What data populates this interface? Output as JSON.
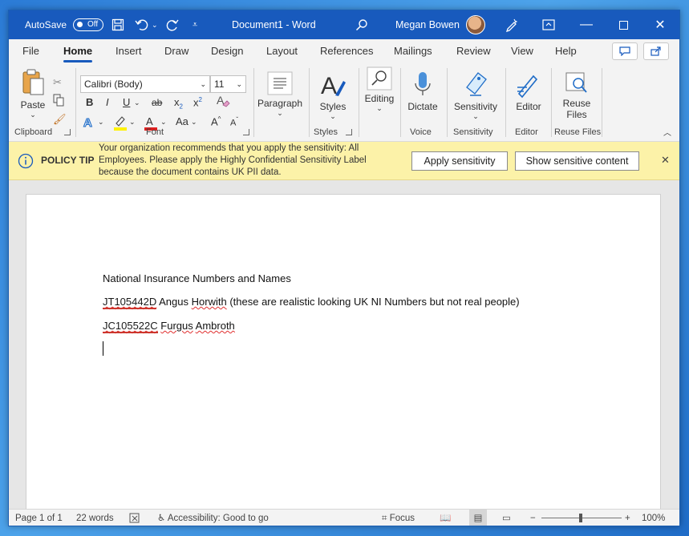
{
  "titlebar": {
    "autosave_label": "AutoSave",
    "autosave_state": "Off",
    "document_title": "Document1 - Word",
    "user_name": "Megan Bowen",
    "icons": [
      "save-icon",
      "undo-icon",
      "redo-icon",
      "customize-icon",
      "search-icon",
      "diamond-pen-icon",
      "ribbon-display-icon",
      "minimize-icon",
      "maximize-icon",
      "close-icon"
    ]
  },
  "tabs": [
    "File",
    "Home",
    "Insert",
    "Draw",
    "Design",
    "Layout",
    "References",
    "Mailings",
    "Review",
    "View",
    "Help"
  ],
  "active_tab": "Home",
  "ribbon": {
    "clipboard": {
      "paste_label": "Paste",
      "group_label": "Clipboard"
    },
    "font": {
      "font_name": "Calibri (Body)",
      "font_size": "11",
      "group_label": "Font",
      "bold": "B",
      "italic": "I",
      "underline": "U",
      "strikethrough": "ab",
      "subscript": "x",
      "sub_mark": "2",
      "superscript": "x",
      "sup_mark": "2",
      "case": "Aa",
      "grow": "A",
      "shrink": "A",
      "font_color_accent": "#e02020",
      "highlight_accent": "#fff200"
    },
    "paragraph": {
      "label": "Paragraph"
    },
    "styles": {
      "label": "Styles",
      "group_label": "Styles"
    },
    "editing": {
      "label": "Editing"
    },
    "voice": {
      "label": "Dictate",
      "group_label": "Voice"
    },
    "sensitivity": {
      "label": "Sensitivity",
      "group_label": "Sensitivity"
    },
    "editor": {
      "label": "Editor",
      "group_label": "Editor"
    },
    "reuse": {
      "label_line1": "Reuse",
      "label_line2": "Files",
      "group_label": "Reuse Files"
    }
  },
  "policy_tip": {
    "title": "POLICY TIP",
    "message_line1": "Your organization recommends that you apply the sensitivity: All",
    "message_line2": "Employees. Please apply the Highly Confidential Sensitivity Label",
    "message_line3": "because the document contains UK PII data.",
    "apply_button": "Apply sensitivity",
    "show_button": "Show sensitive content",
    "close_glyph": "✕"
  },
  "document": {
    "heading": "National Insurance Numbers and Names",
    "row1": {
      "ni": "JT105442D",
      "first": "Angus",
      "last": "Horwith",
      "note": "(these are realistic looking UK NI Numbers but not real people)"
    },
    "row2": {
      "ni": "JC105522C",
      "first": "Furgus",
      "last": "Ambroth"
    }
  },
  "status": {
    "page": "Page 1 of 1",
    "words": "22 words",
    "accessibility": "Accessibility: Good to go",
    "focus": "Focus",
    "zoom": "100%",
    "zoom_minus": "−",
    "zoom_plus": "+"
  },
  "colors": {
    "accent": "#185abd",
    "policy_bg": "#fcf2a8"
  }
}
